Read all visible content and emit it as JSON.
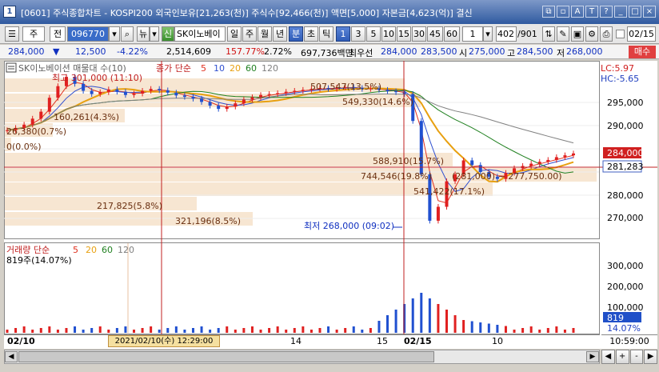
{
  "window": {
    "number": "1",
    "title": "[0601] 주식종합차트 - KOSPI200 외국인보유[21,263(천)] 주식수[92,466(천)] 액면[5,000] 자본금[4,623(억)] 결신",
    "buttons": [
      "⧉",
      "▫",
      "A",
      "T",
      "?",
      "_",
      "□",
      "×"
    ]
  },
  "toolbar": {
    "code_prefix": "주",
    "code_prefix2": "전",
    "stock_code": "096770",
    "news_label": "뉴",
    "credit_badge": "신",
    "stock_name": "SK이노베이",
    "period_buttons": [
      "일",
      "주",
      "월",
      "년",
      "분",
      "초",
      "틱"
    ],
    "active_period": "분",
    "minute_buttons": [
      "1",
      "3",
      "5",
      "10",
      "15",
      "30",
      "45",
      "60"
    ],
    "active_minute": "1",
    "interval_value": "1",
    "count_value": "402",
    "count_total": "/901",
    "date_value": "02/15"
  },
  "price": {
    "current": "284,000",
    "change": "12,500",
    "change_pct": "-4.22%",
    "volume": "2,514,609",
    "volume_ratio": "157.77%",
    "turnover": "2.72%",
    "amount": "697,736백만",
    "best_ask_label": "최우선",
    "ask": "284,000",
    "bid": "283,500",
    "open_label": "시",
    "open": "275,000",
    "high_label": "고",
    "high": "284,500",
    "low_label": "저",
    "low": "268,000",
    "order_button": "매수"
  },
  "chart_data": {
    "type": "candlestick",
    "title": "SK이노베이션 매물대 수(10)",
    "ma_label": "종가 단순",
    "ma_periods": [
      "5",
      "10",
      "20",
      "60",
      "120"
    ],
    "ma_colors": [
      "#e0301e",
      "#3050d0",
      "#e8a010",
      "#208020",
      "#808080"
    ],
    "lc_label": "LC:5.97",
    "hc_label": "HC:-5.65",
    "y_ticks": [
      "295,000",
      "290,000",
      "285,000",
      "280,000",
      "275,000",
      "270,000"
    ],
    "current_price_tag": "284,000",
    "ma_price_tag": "281,283",
    "high_annotation": "최고 301,000 (11:10)",
    "low_annotation": "최저 268,000 (09:02)",
    "profile_labels": [
      "507,547(13.5%)",
      "549,330(14.6%)",
      "160,261(4.3%)",
      "26,380(0.7%)",
      "0(0.0%)",
      "588,910(15.7%)",
      "744,546(19.8%)",
      "(281,000) ~ 277,750.00)",
      "541,422(17.1%)",
      "217,825(5.8%)",
      "321,196(8.5%)"
    ],
    "volume_panel": {
      "title": "거래량 단순",
      "periods": [
        "5",
        "20",
        "60",
        "120"
      ],
      "last_value_label": "819주(14.07%)",
      "y_ticks": [
        "300,000",
        "200,000",
        "100,000"
      ],
      "value_tag": "819",
      "pct_tag": "14.07%"
    },
    "x_labels": [
      "02/10",
      "14",
      "15",
      "02/15",
      "10"
    ],
    "cursor_time": "2021/02/10(수) 12:29:00",
    "price_series": [
      289,
      289.5,
      290.2,
      291.5,
      293,
      296,
      298.5,
      300.5,
      299,
      297.5,
      296.8,
      297.2,
      297.8,
      297.3,
      296.6,
      296.9,
      297.5,
      297.9,
      297.6,
      297.1,
      296.5,
      296.2,
      295.8,
      295.1,
      294.3,
      293.6,
      294.1,
      294.8,
      295.6,
      296.1,
      296.6,
      296.8,
      297,
      297.3,
      297.5,
      297.7,
      297.9,
      298.1,
      297.9,
      298.2,
      298.3,
      298.1,
      297.9,
      298,
      297.7,
      297.4,
      297.2,
      296.8,
      291,
      279.5,
      269.5,
      272.5,
      278,
      279.5,
      282.5,
      281.5,
      280,
      279,
      278.5,
      279.8,
      280.8,
      281.3,
      281.8,
      282.2,
      282.6,
      283.2,
      283.6,
      284
    ]
  },
  "bottom": {
    "time_display": "10:59:00",
    "zoom_buttons": [
      "◀",
      "+",
      "-",
      "▶"
    ]
  }
}
